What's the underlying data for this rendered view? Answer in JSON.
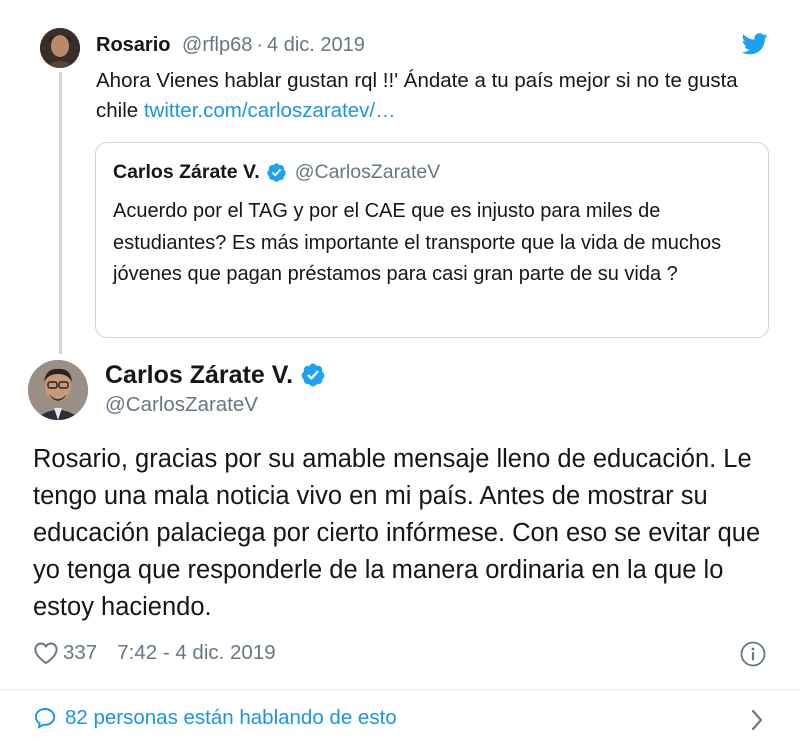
{
  "parent_tweet": {
    "name": "Rosario",
    "handle": "@rflp68",
    "separator": "·",
    "date": "4 dic. 2019",
    "text": "Ahora Vienes  hablar gustan rql !!' Ándate a tu país mejor si no te gusta chile ",
    "link": "twitter.com/carloszaratev/…"
  },
  "quoted_tweet": {
    "name": "Carlos Zárate V.",
    "handle": "@CarlosZarateV",
    "text": "Acuerdo por el TAG y por el CAE que es injusto para miles de estudiantes? Es más importante el transporte que la vida de muchos jóvenes que pagan préstamos para casi gran parte de su vida ?"
  },
  "main_tweet": {
    "name": "Carlos Zárate V.",
    "handle": "@CarlosZarateV",
    "text": "Rosario, gracias por su amable mensaje lleno de educación. Le tengo una mala noticia vivo en mi país. Antes de mostrar su educación palaciega por cierto infórmese. Con eso se evitar que yo tenga que responderle de la manera ordinaria en la que lo estoy haciendo.",
    "likes": "337",
    "timestamp": "7:42 - 4 dic. 2019",
    "talking": "82 personas están hablando de esto"
  },
  "icons": {
    "brand": "twitter-bird-icon",
    "verified": "verified-badge-icon",
    "like": "heart-icon",
    "info": "info-icon",
    "talking": "speech-bubble-icon",
    "more": "chevron-right-icon"
  },
  "colors": {
    "accent": "#1da1f2",
    "link": "#1b95e0",
    "muted": "#657786",
    "border": "#ccd6dd"
  }
}
